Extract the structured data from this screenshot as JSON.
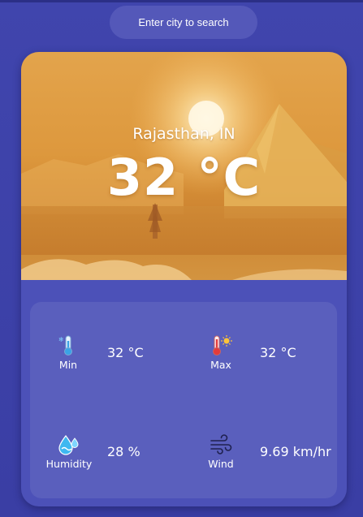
{
  "search": {
    "placeholder": "Enter city to search"
  },
  "weather": {
    "location": "Rajasthan, IN",
    "temperature": "32 °C",
    "background_theme": "sunny-desert"
  },
  "stats": {
    "min": {
      "label": "Min",
      "value": "32 °C",
      "icon": "thermometer-cold-icon"
    },
    "max": {
      "label": "Max",
      "value": "32 °C",
      "icon": "thermometer-hot-icon"
    },
    "humidity": {
      "label": "Humidity",
      "value": "28 %",
      "icon": "humidity-icon"
    },
    "wind": {
      "label": "Wind",
      "value": "9.69 km/hr",
      "icon": "wind-icon"
    }
  },
  "colors": {
    "background": "#3b3fa6",
    "card": "#4c51b8",
    "stats_panel": "#5a5fbd",
    "search_field": "#5458b9",
    "hero_top": "#e3a44c",
    "text": "#ffffff"
  }
}
